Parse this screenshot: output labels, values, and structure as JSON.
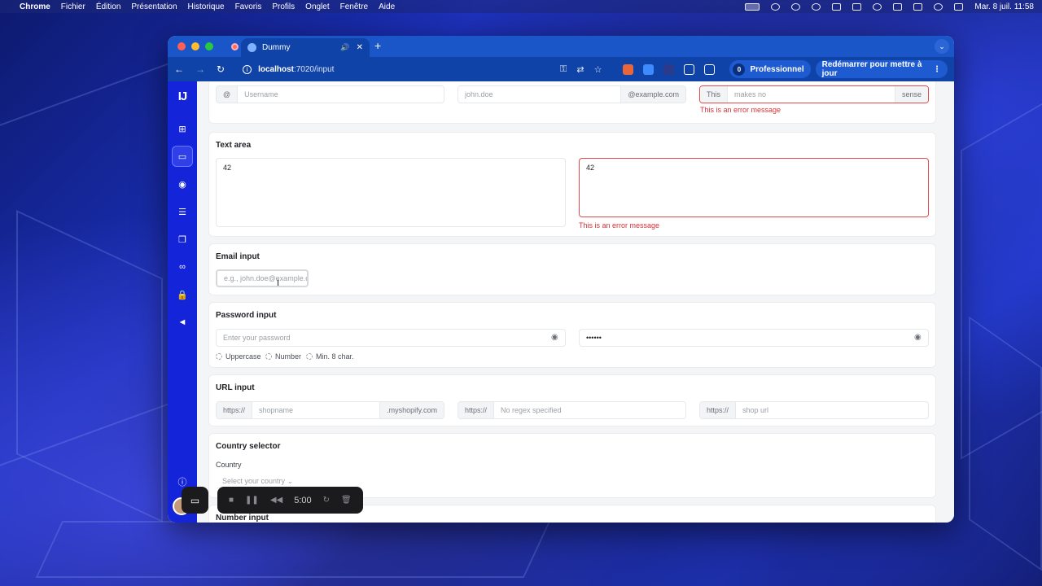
{
  "menubar": {
    "app": "Chrome",
    "items": [
      "Fichier",
      "Édition",
      "Présentation",
      "Historique",
      "Favoris",
      "Profils",
      "Onglet",
      "Fenêtre",
      "Aide"
    ],
    "clock": "Mar. 8 juil. 11:58"
  },
  "browser": {
    "tab_title": "Dummy",
    "url_host": "localhost",
    "url_path": ":7020/input",
    "profile_count": "0",
    "profile_label": "Professionnel",
    "restart_label": "Redémarrer pour mettre à jour"
  },
  "app": {
    "logo": "IJ"
  },
  "top_row": {
    "username_addon": "@",
    "username_placeholder": "Username",
    "email_placeholder": "john.doe",
    "email_suffix": "@example.com",
    "sense_prefix": "This",
    "sense_placeholder": "makes no",
    "sense_suffix": "sense",
    "error": "This is an error message"
  },
  "textarea": {
    "title": "Text area",
    "value1": "42",
    "value2": "42",
    "error": "This is an error message"
  },
  "email": {
    "title": "Email input",
    "placeholder": "e.g., john.doe@example.c"
  },
  "password": {
    "title": "Password input",
    "placeholder": "Enter your password",
    "masked": "••••••",
    "rules": [
      "Uppercase",
      "Number",
      "Min. 8 char."
    ]
  },
  "url": {
    "title": "URL input",
    "f1_prefix": "https://",
    "f1_placeholder": "shopname",
    "f1_suffix": ".myshopify.com",
    "f2_prefix": "https://",
    "f2_placeholder": "No regex specified",
    "f3_prefix": "https://",
    "f3_placeholder": "shop url"
  },
  "country": {
    "title": "Country selector",
    "label": "Country",
    "placeholder": "Select your country"
  },
  "number": {
    "title": "Number input"
  },
  "recorder": {
    "timer": "5:00"
  }
}
